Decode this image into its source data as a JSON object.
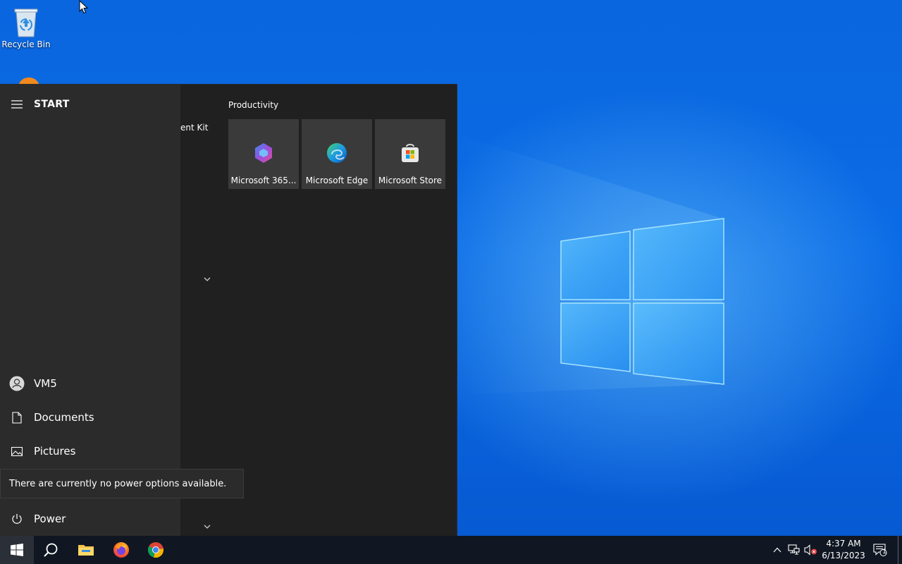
{
  "desktop": {
    "icons": [
      {
        "label": "Recycle Bin",
        "icon": "recycle-bin-icon"
      }
    ]
  },
  "start_menu": {
    "title": "START",
    "cutoff_item_text": "ent Kit",
    "group_label": "Productivity",
    "tiles": [
      {
        "label": "Microsoft 365...",
        "icon": "microsoft-365-icon"
      },
      {
        "label": "Microsoft Edge",
        "icon": "edge-icon"
      },
      {
        "label": "Microsoft Store",
        "icon": "store-icon"
      }
    ],
    "rail": {
      "user": "VM5",
      "documents": "Documents",
      "pictures": "Pictures",
      "power": "Power"
    },
    "power_tooltip": "There are currently no power options available."
  },
  "taskbar": {
    "pinned": [
      "windows-logo-icon",
      "search-icon",
      "file-explorer-icon",
      "firefox-icon",
      "chrome-icon"
    ],
    "clock": {
      "time": "4:37 AM",
      "date": "6/13/2023"
    },
    "notification_count": "1"
  },
  "colors": {
    "start_background": "#202020",
    "start_rail": "#2b2b2b",
    "tile": "#3a3a3a",
    "taskbar": "#101722",
    "desktop_blue": "#0a66de"
  }
}
